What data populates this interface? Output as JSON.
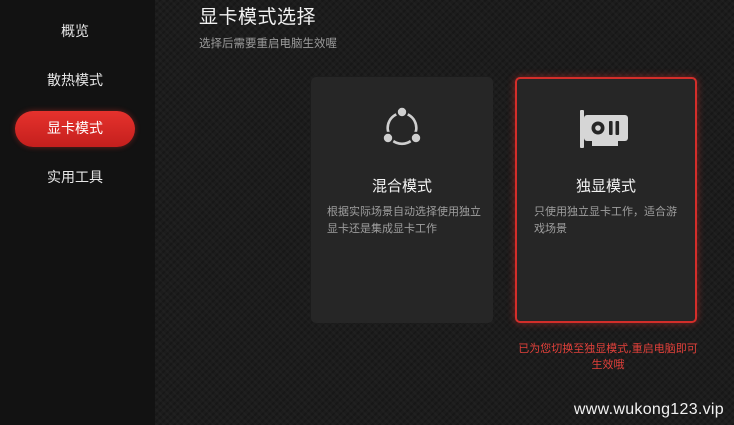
{
  "sidebar": {
    "items": [
      {
        "label": "概览"
      },
      {
        "label": "散热模式"
      },
      {
        "label": "显卡模式"
      },
      {
        "label": "实用工具"
      }
    ],
    "active_index": 2
  },
  "header": {
    "title": "显卡模式选择",
    "subtitle": "选择后需要重启电脑生效喔"
  },
  "cards": {
    "mixed": {
      "icon": "share-nodes-icon",
      "title": "混合模式",
      "desc": "根据实际场景自动选择使用独立显卡还是集成显卡工作"
    },
    "discrete": {
      "icon": "graphics-card-icon",
      "title": "独显模式",
      "desc": "只使用独立显卡工作，适合游戏场景",
      "selected": true
    }
  },
  "notice": "已为您切换至独显模式,重启电脑即可生效哦",
  "watermark": "www.wukong123.vip",
  "colors": {
    "accent": "#d42e2a",
    "background": "#1c1c1c",
    "sidebar": "#121212",
    "card": "#262626"
  }
}
